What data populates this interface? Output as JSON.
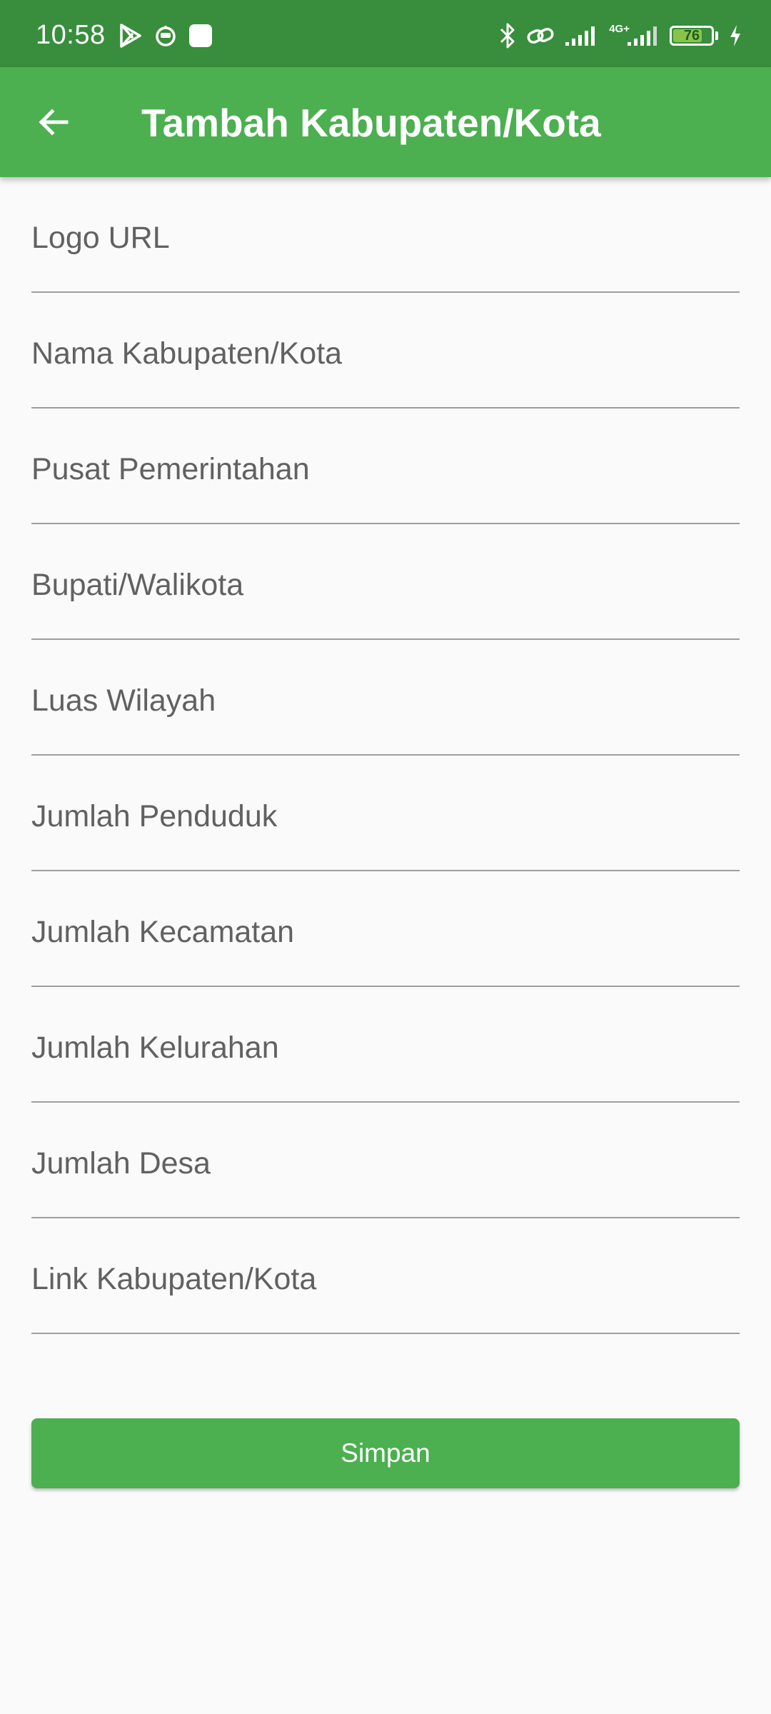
{
  "status_bar": {
    "time": "10:58",
    "network_label": "4G+",
    "battery_level": "76",
    "battery_fraction": 0.76,
    "icons": [
      "play-store-icon",
      "robot-notification-icon",
      "app-notification-icon",
      "bluetooth-icon",
      "link-icon",
      "signal-icon",
      "signal-4g-icon",
      "battery-icon",
      "charging-icon"
    ]
  },
  "app_bar": {
    "title": "Tambah Kabupaten/Kota",
    "back_icon": "arrow-back-icon"
  },
  "form": {
    "fields": [
      {
        "placeholder": "Logo URL",
        "value": ""
      },
      {
        "placeholder": "Nama Kabupaten/Kota",
        "value": ""
      },
      {
        "placeholder": "Pusat Pemerintahan",
        "value": ""
      },
      {
        "placeholder": "Bupati/Walikota",
        "value": ""
      },
      {
        "placeholder": "Luas Wilayah",
        "value": ""
      },
      {
        "placeholder": "Jumlah Penduduk",
        "value": ""
      },
      {
        "placeholder": "Jumlah Kecamatan",
        "value": ""
      },
      {
        "placeholder": "Jumlah Kelurahan",
        "value": ""
      },
      {
        "placeholder": "Jumlah Desa",
        "value": ""
      },
      {
        "placeholder": "Link Kabupaten/Kota",
        "value": ""
      }
    ],
    "submit_label": "Simpan"
  },
  "colors": {
    "status_bar": "#388e3c",
    "primary": "#4caf50",
    "background": "#fafafa",
    "underline": "#9e9e9e",
    "placeholder": "#616161"
  }
}
